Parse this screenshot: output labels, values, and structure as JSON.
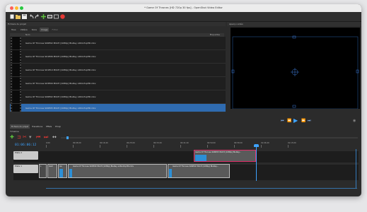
{
  "window": {
    "title": "* Game Of Thrones [HD 720p 30 fps] - OpenShot Video Editor"
  },
  "toolbar": {
    "icons": [
      "new-project-icon",
      "open-project-icon",
      "save-project-icon",
      "undo-icon",
      "redo-icon",
      "import-files-icon",
      "profile-icon",
      "fullscreen-icon",
      "record-icon"
    ]
  },
  "project_files": {
    "title": "Fichiers du projet",
    "tabs": [
      "Tous",
      "Vidéos",
      "Sons",
      "Image",
      "Filtrer"
    ],
    "columns": {
      "name": "Nom",
      "tags": "Étiquettes"
    },
    "files": [
      "Game Of Thrones S06E02 MULTI [1080p] BluRay x264-PopHD.mkv",
      "Game Of Thrones S01E06 MULTI [1080p] BluRay x264-PopHD.mkv",
      "Game Of Thrones S01E10 MULTI [1080p] BluRay x264-PopHD.mkv",
      "Game Of Thrones S03E09 MULTI [1080p] BluRay x264-PopHD.mkv",
      "Game Of Thrones S06E02 MULTI [1080p] BluRay x264-PopHD.mkv",
      "Game Of Thrones S06E05 MULTI [1080p] BluRay x264-PopHD.mkv"
    ],
    "selected_index": 5
  },
  "video_preview": {
    "title": "Aperçu vidéo"
  },
  "playback": {
    "icons": [
      "jump-start-icon",
      "rewind-icon",
      "play-icon",
      "fast-forward-icon",
      "jump-end-icon"
    ],
    "accent": "#3ea3ff"
  },
  "bottom_tabs": [
    "Fichiers du projet",
    "Transitions",
    "Effets",
    "Emoji"
  ],
  "timeline": {
    "title": "Timeline",
    "current_time": "01:06:06:12",
    "ruler_ticks": [
      "0:00",
      "00:08:20",
      "00:16:40",
      "00:25:00",
      "00:33:20",
      "00:41:40",
      "00:50:00",
      "00:58:20",
      "01:06:40",
      "01:15:00"
    ],
    "tracks": [
      {
        "label": "Piste 2",
        "clips": [
          {
            "title": "Game Of Thrones S06E05 MULTI [1080p] BluRay..."
          }
        ]
      },
      {
        "label": "Piste 1",
        "clips": [
          {
            "title": "L"
          },
          {
            "title": "Gam"
          },
          {
            "title": "Ga"
          },
          {
            "title": "Game Of Thrones S03E09 MULTI [1080p] BluRay x264-PopHD.mkv"
          },
          {
            "title": "Game Of Thrones S06E02 MULTI [1080p] BluRay..."
          }
        ]
      }
    ]
  },
  "colors": {
    "selection": "#2f6bb0",
    "playhead": "#3ea3ff",
    "selected_clip_border": "#e0306a"
  }
}
